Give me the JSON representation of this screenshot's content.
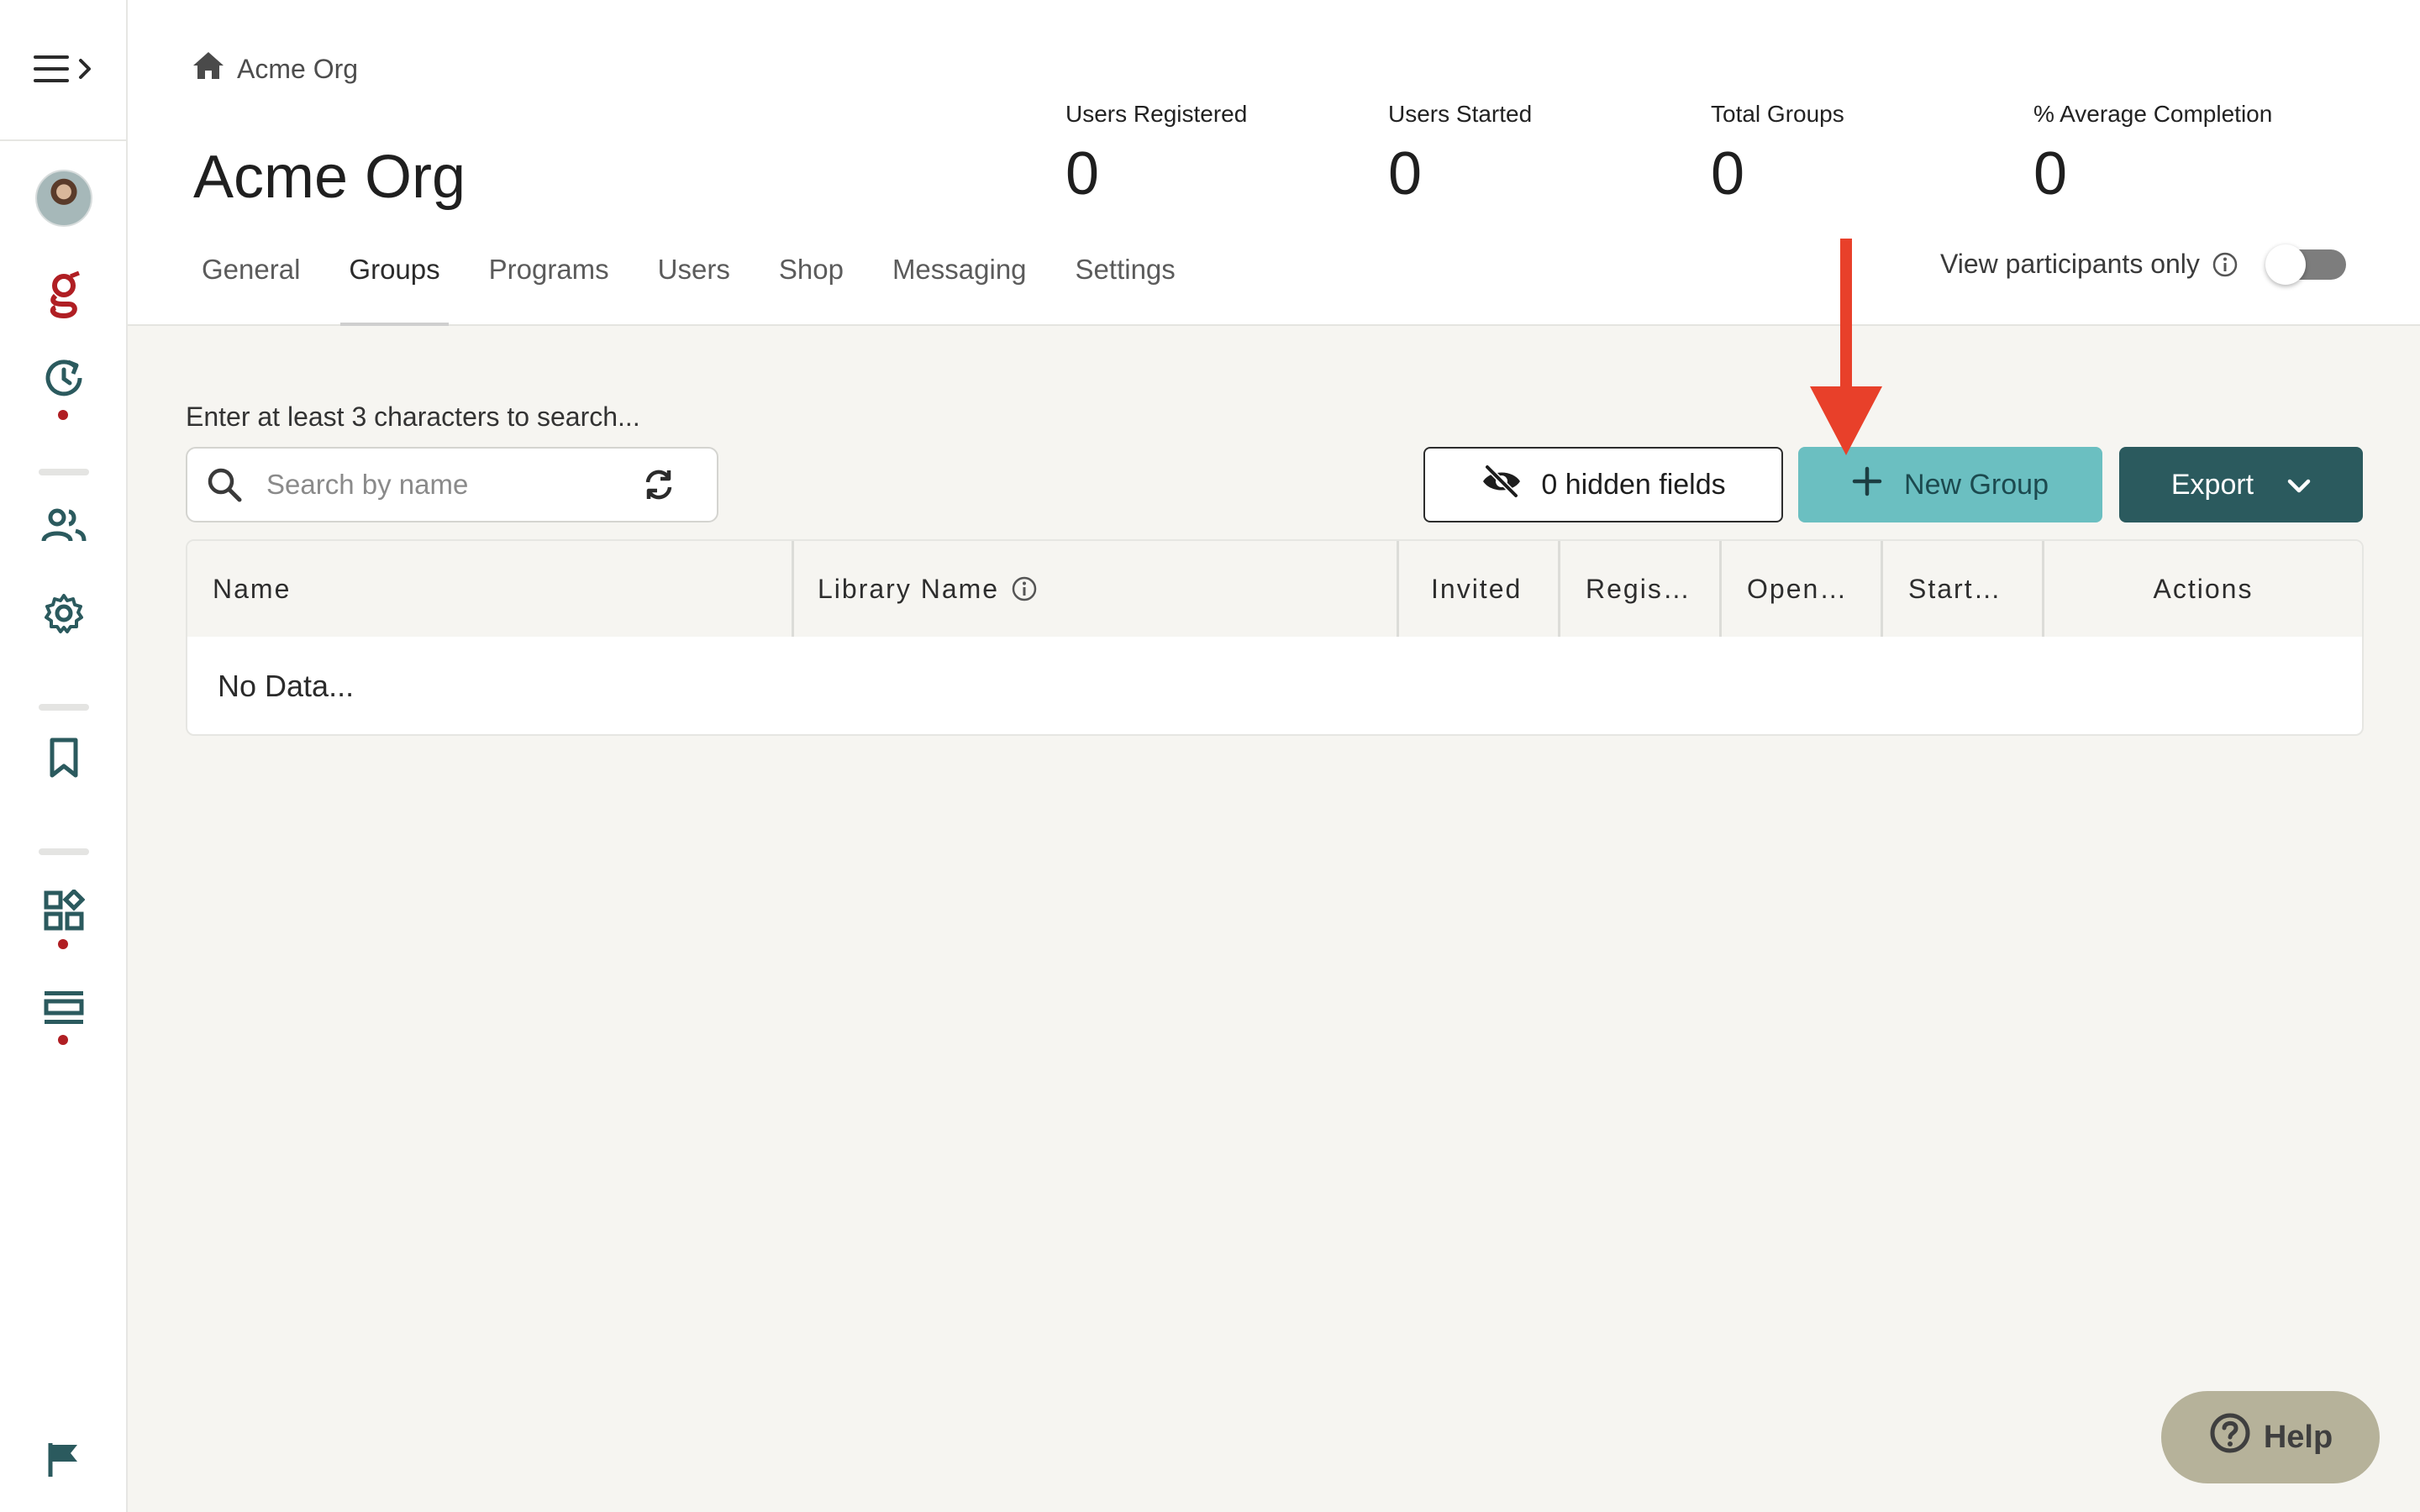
{
  "sidebar": {
    "items": [
      {
        "name": "menu-icon"
      },
      {
        "name": "avatar"
      },
      {
        "name": "g-logo-icon"
      },
      {
        "name": "history-icon"
      },
      {
        "name": "people-icon"
      },
      {
        "name": "gear-icon"
      },
      {
        "name": "bookmark-icon"
      },
      {
        "name": "widgets-icon"
      },
      {
        "name": "layout-icon"
      },
      {
        "name": "flag-icon"
      }
    ],
    "accent_color": "#b01e23",
    "icon_color": "#2b5a5e"
  },
  "breadcrumb": {
    "label": "Acme Org",
    "icon": "home-icon"
  },
  "page_title": "Acme Org",
  "stats": [
    {
      "label": "Users Registered",
      "value": "0"
    },
    {
      "label": "Users Started",
      "value": "0"
    },
    {
      "label": "Total Groups",
      "value": "0"
    },
    {
      "label": "% Average Completion",
      "value": "0"
    }
  ],
  "tabs": [
    {
      "label": "General",
      "active": false
    },
    {
      "label": "Groups",
      "active": true
    },
    {
      "label": "Programs",
      "active": false
    },
    {
      "label": "Users",
      "active": false
    },
    {
      "label": "Shop",
      "active": false
    },
    {
      "label": "Messaging",
      "active": false
    },
    {
      "label": "Settings",
      "active": false
    }
  ],
  "toggle": {
    "label": "View participants only",
    "on": false
  },
  "search": {
    "hint": "Enter at least 3 characters to search...",
    "placeholder": "Search by name",
    "value": ""
  },
  "buttons": {
    "hidden_fields": "0 hidden fields",
    "new_group": "New Group",
    "export": "Export"
  },
  "table": {
    "columns": [
      "Name",
      "Library Name",
      "Invited",
      "Regis…",
      "Open…",
      "Start…",
      "Actions"
    ],
    "empty_text": "No Data..."
  },
  "help": {
    "label": "Help"
  },
  "colors": {
    "primary_dark": "#2b5a5e",
    "primary_light": "#6bbfc1",
    "arrow": "#e8402a",
    "background": "#f6f5f1"
  }
}
